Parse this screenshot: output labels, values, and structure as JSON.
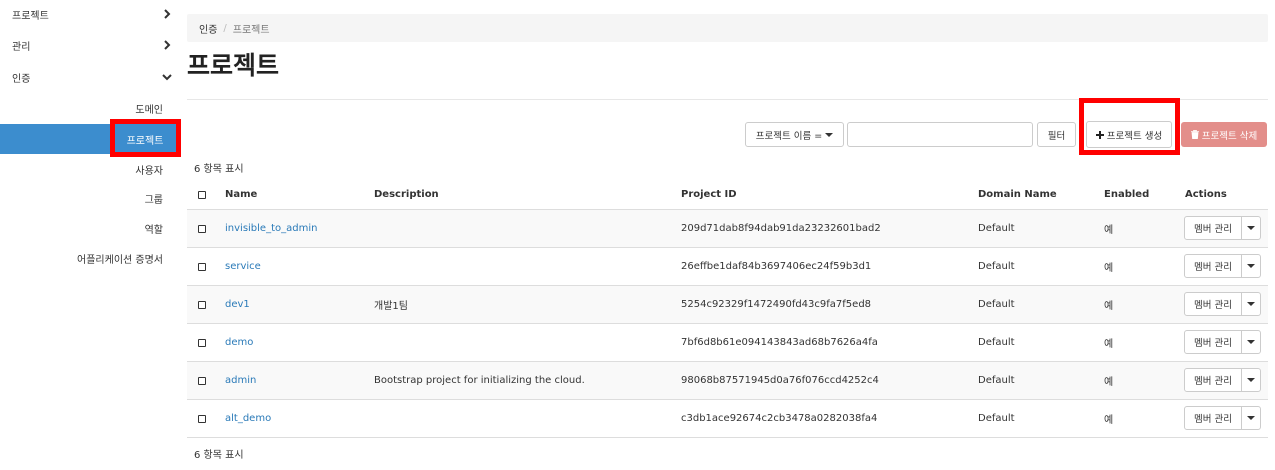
{
  "sidebar": {
    "top_items": [
      {
        "label": "프로젝트",
        "state": "collapsed"
      },
      {
        "label": "관리",
        "state": "collapsed"
      },
      {
        "label": "인증",
        "state": "expanded"
      }
    ],
    "sub_items": [
      {
        "label": "도메인"
      },
      {
        "label": "프로젝트",
        "active": true
      },
      {
        "label": "사용자"
      },
      {
        "label": "그룹"
      },
      {
        "label": "역할"
      },
      {
        "label": "어플리케이션 증명서"
      }
    ]
  },
  "breadcrumb": {
    "parent": "인증",
    "separator": "/",
    "current": "프로젝트"
  },
  "page_title": "프로젝트",
  "toolbar": {
    "filter_field": "프로젝트 이름 =",
    "filter_value": "",
    "filter_button": "필터",
    "create_button": "프로젝트 생성",
    "delete_button": "프로젝트 삭제"
  },
  "count_text": "6 항목 표시",
  "table": {
    "headers": {
      "name": "Name",
      "description": "Description",
      "project_id": "Project ID",
      "domain": "Domain Name",
      "enabled": "Enabled",
      "actions": "Actions"
    },
    "rows": [
      {
        "name": "invisible_to_admin",
        "description": "",
        "project_id": "209d71dab8f94dab91da23232601bad2",
        "domain": "Default",
        "enabled": "예",
        "action": "멤버 관리"
      },
      {
        "name": "service",
        "description": "",
        "project_id": "26effbe1daf84b3697406ec24f59b3d1",
        "domain": "Default",
        "enabled": "예",
        "action": "멤버 관리"
      },
      {
        "name": "dev1",
        "description": "개발1팀",
        "project_id": "5254c92329f1472490fd43c9fa7f5ed8",
        "domain": "Default",
        "enabled": "예",
        "action": "멤버 관리"
      },
      {
        "name": "demo",
        "description": "",
        "project_id": "7bf6d8b61e094143843ad68b7626a4fa",
        "domain": "Default",
        "enabled": "예",
        "action": "멤버 관리"
      },
      {
        "name": "admin",
        "description": "Bootstrap project for initializing the cloud.",
        "project_id": "98068b87571945d0a76f076ccd4252c4",
        "domain": "Default",
        "enabled": "예",
        "action": "멤버 관리"
      },
      {
        "name": "alt_demo",
        "description": "",
        "project_id": "c3db1ace92674c2cb3478a0282038fa4",
        "domain": "Default",
        "enabled": "예",
        "action": "멤버 관리"
      }
    ]
  },
  "colors": {
    "active_nav": "#3c8dce",
    "link": "#2a7ab8",
    "danger_button": "#e38e8a",
    "highlight_box": "#ff0000"
  }
}
